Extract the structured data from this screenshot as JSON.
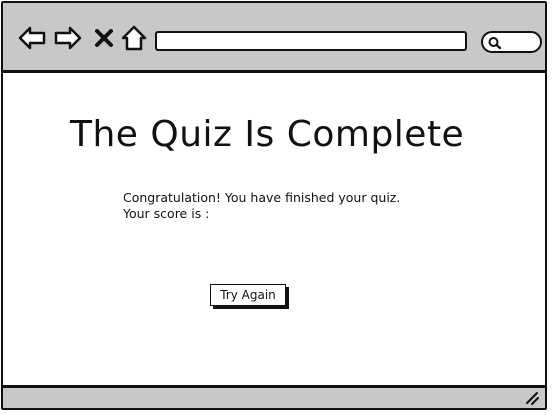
{
  "toolbar": {
    "icons": {
      "back": "back-arrow-icon",
      "forward": "forward-arrow-icon",
      "close": "close-icon",
      "home": "home-icon",
      "search": "search-icon"
    },
    "url_value": "",
    "search_value": ""
  },
  "main": {
    "title": "The Quiz Is Complete",
    "message_line1": "Congratulation! You have finished your quiz.",
    "message_line2": "Your score is :",
    "try_again_label": "Try Again"
  },
  "colors": {
    "chrome": "#c8c8c8",
    "ink": "#111111",
    "background": "#ffffff"
  }
}
